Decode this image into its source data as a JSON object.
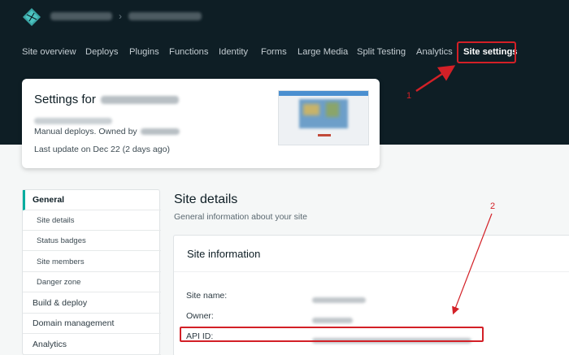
{
  "nav": {
    "items": [
      {
        "label": "Site overview"
      },
      {
        "label": "Deploys"
      },
      {
        "label": "Plugins"
      },
      {
        "label": "Functions"
      },
      {
        "label": "Identity"
      },
      {
        "label": "Forms"
      },
      {
        "label": "Large Media"
      },
      {
        "label": "Split Testing"
      },
      {
        "label": "Analytics"
      },
      {
        "label": "Site settings"
      }
    ],
    "active": "Site settings"
  },
  "site_card": {
    "title_prefix": "Settings for",
    "deploy_text": "Manual deploys. Owned by",
    "update_text": "Last update on Dec 22 (2 days ago)"
  },
  "sidebar": {
    "items": [
      {
        "label": "General"
      },
      {
        "label": "Site details"
      },
      {
        "label": "Status badges"
      },
      {
        "label": "Site members"
      },
      {
        "label": "Danger zone"
      },
      {
        "label": "Build & deploy"
      },
      {
        "label": "Domain management"
      },
      {
        "label": "Analytics"
      }
    ]
  },
  "main": {
    "title": "Site details",
    "description": "General information about your site",
    "card_title": "Site information",
    "rows": [
      {
        "label": "Site name:"
      },
      {
        "label": "Owner:"
      },
      {
        "label": "API ID:"
      }
    ]
  },
  "annotations": {
    "one": "1",
    "two": "2"
  },
  "colors": {
    "header_bg": "#0e1e25",
    "accent_teal": "#00ad9f",
    "annotation_red": "#d32027"
  }
}
